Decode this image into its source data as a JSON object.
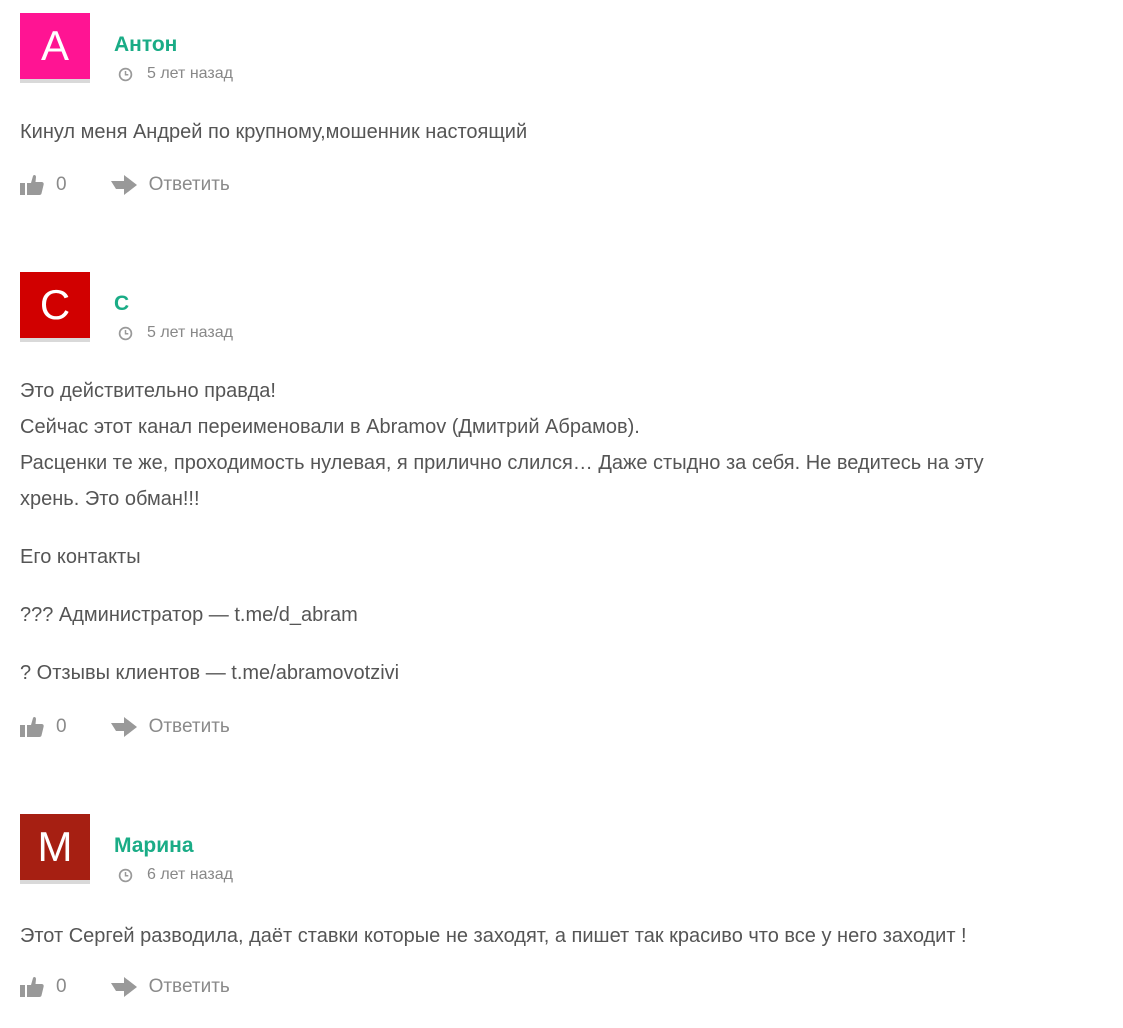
{
  "comments": [
    {
      "avatar_letter": "А",
      "avatar_color": "#ff1493",
      "author": "Антон",
      "time": "5 лет назад",
      "paragraphs": [
        "Кинул меня Андрей по крупному,мошенник настоящий"
      ],
      "likes": "0",
      "reply_label": "Ответить"
    },
    {
      "avatar_letter": "С",
      "avatar_color": "#d10000",
      "author": "С",
      "time": "5 лет назад",
      "paragraphs": [
        "Это действительно правда!",
        "Сейчас этот канал переименовали в Abramov (Дмитрий Абрамов).",
        "Расценки те же, проходимость нулевая, я прилично слился… Даже стыдно за себя. Не ведитесь на эту",
        "хрень. Это обман!!!",
        "Его контакты",
        "??? Администратор — t.me/d_abram",
        "? Отзывы клиентов — t.me/abramovotzivi"
      ],
      "likes": "0",
      "reply_label": "Ответить"
    },
    {
      "avatar_letter": "М",
      "avatar_color": "#a61f12",
      "author": "Марина",
      "time": "6 лет назад",
      "paragraphs": [
        "Этот Сергей разводила, даёт ставки которые не заходят, а пишет так красиво что все у него заходит !"
      ],
      "likes": "0",
      "reply_label": "Ответить"
    }
  ]
}
